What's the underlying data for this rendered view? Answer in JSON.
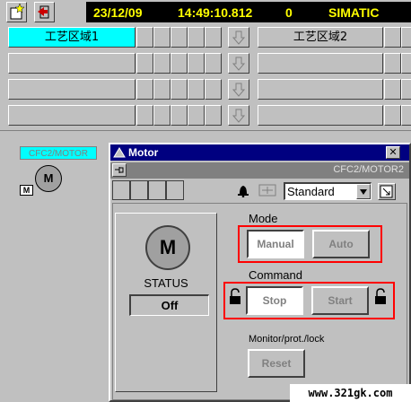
{
  "header": {
    "date": "23/12/09",
    "time": "14:49:10.812",
    "alarm_count": "0",
    "brand": "SIMATIC"
  },
  "areas": {
    "area1_label": "工艺区域1",
    "area2_label": "工艺区域2"
  },
  "overview": {
    "tag_label": "CFC2/MOTOR",
    "mode_badge": "M",
    "motor_symbol": "M"
  },
  "dialog": {
    "title": "Motor",
    "close_symbol": "✕",
    "tag": "CFC2/MOTOR2",
    "view_select": "Standard",
    "motor_symbol": "M",
    "status_label": "STATUS",
    "status_value": "Off",
    "mode_label": "Mode",
    "manual_label": "Manual",
    "auto_label": "Auto",
    "command_label": "Command",
    "stop_label": "Stop",
    "start_label": "Start",
    "monitor_label": "Monitor/prot./lock",
    "reset_label": "Reset"
  },
  "watermark": "www.321gk.com",
  "colors": {
    "active_area": "#00ffff",
    "highlight_box": "#ff0000",
    "title_bar": "#000080",
    "status_text": "#ffff00"
  }
}
